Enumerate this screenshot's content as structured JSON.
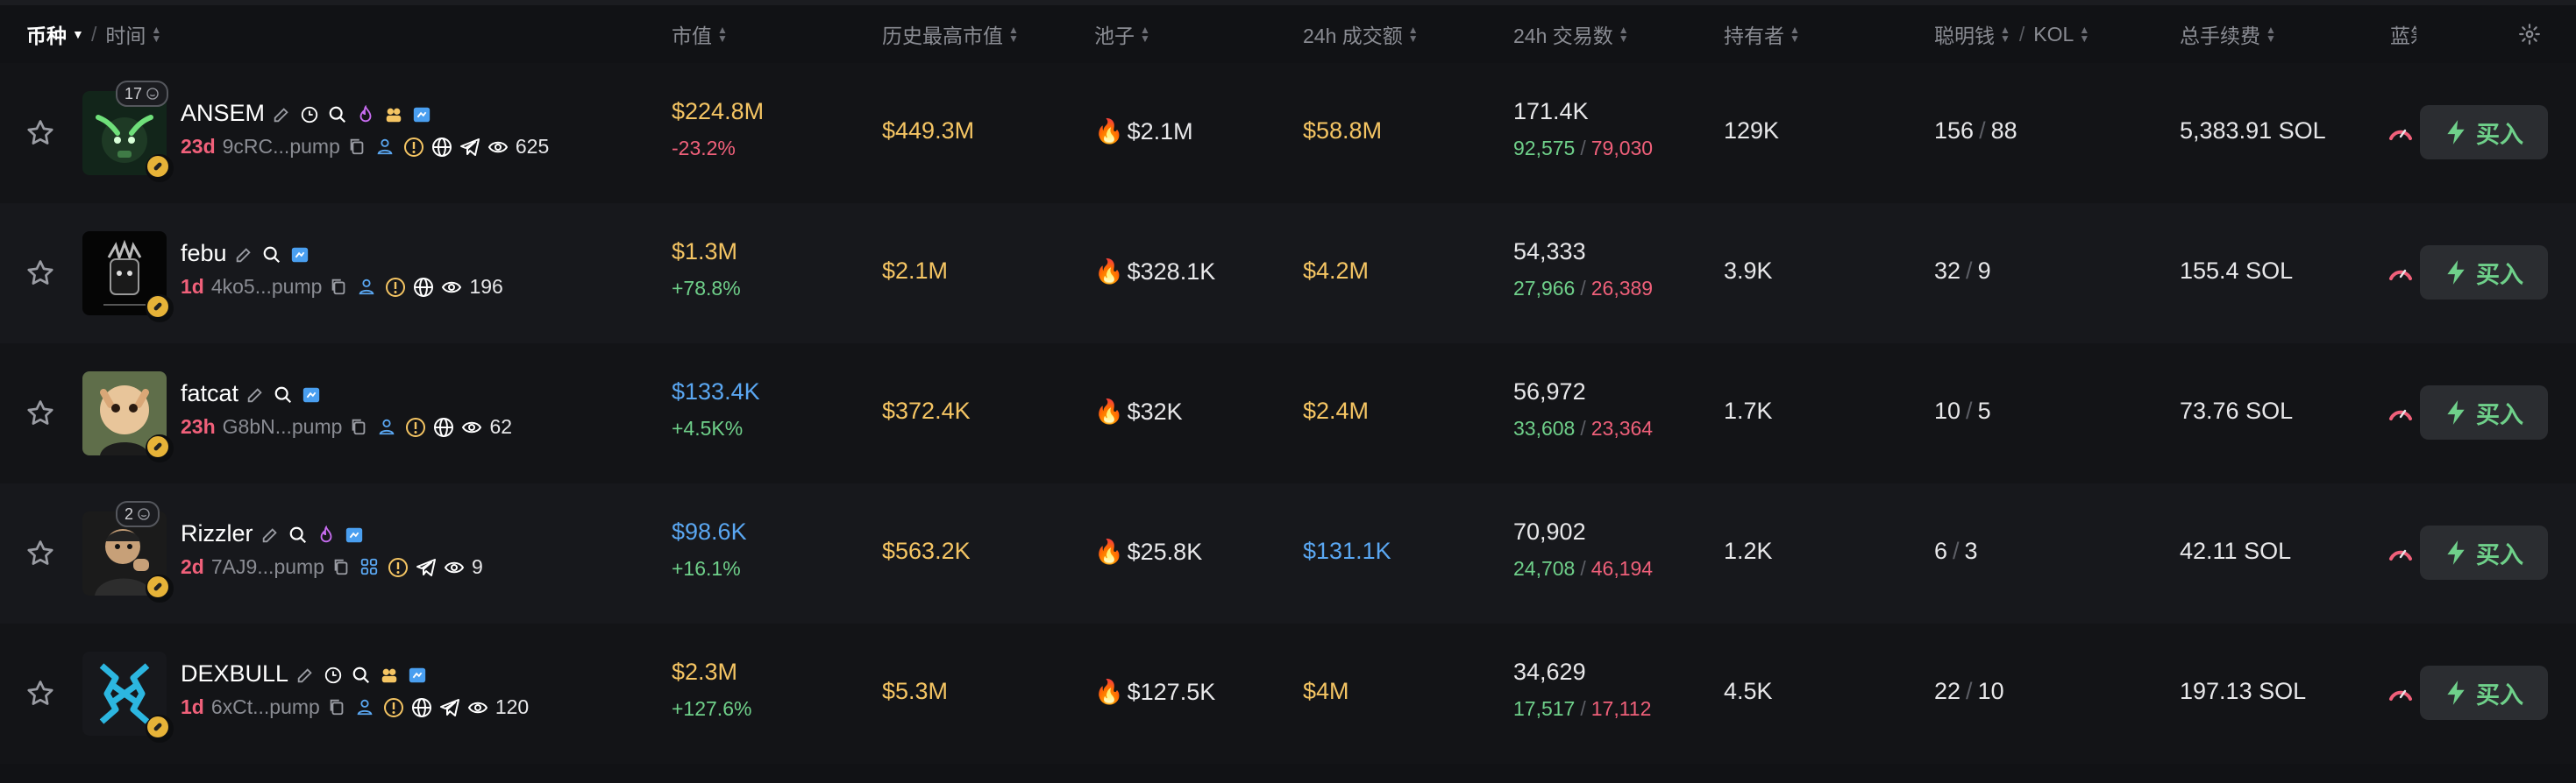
{
  "header": {
    "coin_label": "币种",
    "time_label": "时间",
    "market_cap": "市值",
    "ath_market_cap": "历史最高市值",
    "pool": "池子",
    "volume_24h": "24h 成交额",
    "txns_24h": "24h 交易数",
    "holders": "持有者",
    "smart_money": "聪明钱",
    "kol": "KOL",
    "total_fees": "总手续费",
    "bluechip": "蓝筹"
  },
  "buy_label": "买入",
  "colors": {
    "positive": "#6fd08a",
    "negative": "#f0607a",
    "cap_yellow": "#f5c563",
    "cap_blue": "#5aa7f2"
  },
  "rows": [
    {
      "count_badge": "17",
      "name": "ANSEM",
      "name_icons": [
        "edit-icon",
        "clock-icon",
        "search-icon",
        "fire-icon",
        "users-icon",
        "verified-icon"
      ],
      "age": "23d",
      "address": "9cRC...pump",
      "sub_icons": [
        "copy-icon",
        "user-icon",
        "warning-icon",
        "globe-icon",
        "telegram-icon"
      ],
      "views": "625",
      "market_cap": "$224.8M",
      "market_cap_color": "yellow",
      "change": "-23.2%",
      "change_color": "red",
      "ath": "$449.3M",
      "ath_color": "yellow",
      "pool": "$2.1M",
      "volume": "$58.8M",
      "volume_color": "yellow",
      "txns": "171.4K",
      "buys": "92,575",
      "sells": "79,030",
      "holders": "129K",
      "smart": "156",
      "kol": "88",
      "fees": "5,383.91 SOL"
    },
    {
      "count_badge": "",
      "name": "febu",
      "name_icons": [
        "edit-icon",
        "search-icon",
        "verified-icon"
      ],
      "age": "1d",
      "address": "4ko5...pump",
      "sub_icons": [
        "copy-icon",
        "user-icon",
        "warning-icon",
        "globe-icon"
      ],
      "views": "196",
      "market_cap": "$1.3M",
      "market_cap_color": "yellow",
      "change": "+78.8%",
      "change_color": "green",
      "ath": "$2.1M",
      "ath_color": "yellow",
      "pool": "$328.1K",
      "volume": "$4.2M",
      "volume_color": "yellow",
      "txns": "54,333",
      "buys": "27,966",
      "sells": "26,389",
      "holders": "3.9K",
      "smart": "32",
      "kol": "9",
      "fees": "155.4 SOL"
    },
    {
      "count_badge": "",
      "name": "fatcat",
      "name_icons": [
        "edit-icon",
        "search-icon",
        "verified-icon"
      ],
      "age": "23h",
      "address": "G8bN...pump",
      "sub_icons": [
        "copy-icon",
        "user-icon",
        "warning-icon",
        "globe-icon"
      ],
      "views": "62",
      "market_cap": "$133.4K",
      "market_cap_color": "blue",
      "change": "+4.5K%",
      "change_color": "green",
      "ath": "$372.4K",
      "ath_color": "yellow",
      "pool": "$32K",
      "volume": "$2.4M",
      "volume_color": "yellow",
      "txns": "56,972",
      "buys": "33,608",
      "sells": "23,364",
      "holders": "1.7K",
      "smart": "10",
      "kol": "5",
      "fees": "73.76 SOL"
    },
    {
      "count_badge": "2",
      "name": "Rizzler",
      "name_icons": [
        "edit-icon",
        "search-icon",
        "fire-icon",
        "verified-icon"
      ],
      "age": "2d",
      "address": "7AJ9...pump",
      "sub_icons": [
        "copy-icon",
        "grid-icon",
        "warning-icon",
        "telegram-icon"
      ],
      "views": "9",
      "market_cap": "$98.6K",
      "market_cap_color": "blue",
      "change": "+16.1%",
      "change_color": "green",
      "ath": "$563.2K",
      "ath_color": "yellow",
      "pool": "$25.8K",
      "volume": "$131.1K",
      "volume_color": "blue",
      "txns": "70,902",
      "buys": "24,708",
      "sells": "46,194",
      "holders": "1.2K",
      "smart": "6",
      "kol": "3",
      "fees": "42.11 SOL"
    },
    {
      "count_badge": "",
      "name": "DEXBULL",
      "name_icons": [
        "edit-icon",
        "clock-icon",
        "search-icon",
        "users-icon",
        "verified-icon"
      ],
      "age": "1d",
      "address": "6xCt...pump",
      "sub_icons": [
        "copy-icon",
        "user-icon",
        "warning-icon",
        "globe-icon",
        "telegram-icon"
      ],
      "views": "120",
      "market_cap": "$2.3M",
      "market_cap_color": "yellow",
      "change": "+127.6%",
      "change_color": "green",
      "ath": "$5.3M",
      "ath_color": "yellow",
      "pool": "$127.5K",
      "volume": "$4M",
      "volume_color": "yellow",
      "txns": "34,629",
      "buys": "17,517",
      "sells": "17,112",
      "holders": "4.5K",
      "smart": "22",
      "kol": "10",
      "fees": "197.13 SOL"
    }
  ]
}
